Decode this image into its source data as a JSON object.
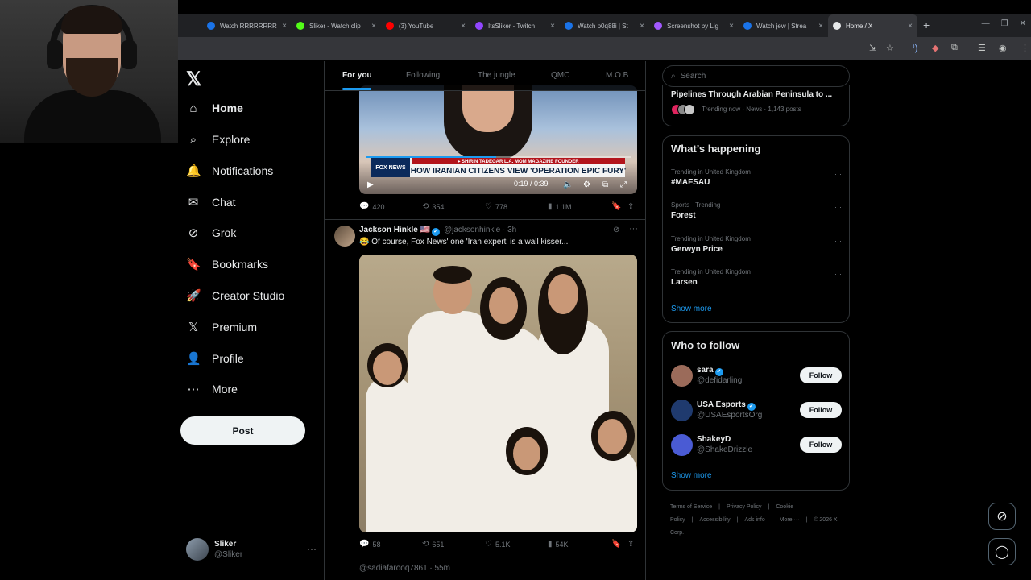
{
  "browser": {
    "tabs": [
      {
        "label": "Watch RRRRRRRR",
        "color": "#1a73e8"
      },
      {
        "label": "Sliker - Watch clip",
        "color": "#53fc18"
      },
      {
        "label": "(3) YouTube",
        "color": "#ff0000"
      },
      {
        "label": "ItsSliker - Twitch",
        "color": "#9146ff"
      },
      {
        "label": "Watch p0q88i | St",
        "color": "#1a73e8"
      },
      {
        "label": "Screenshot by Lig",
        "color": "#a259ff"
      },
      {
        "label": "Watch jew | Strea",
        "color": "#1a73e8"
      },
      {
        "label": "Home / X",
        "color": "#e7e9ea"
      }
    ],
    "new_tab": "+",
    "close_glyph": "×",
    "window_controls": [
      "—",
      "❐",
      "✕"
    ],
    "toolbar_icons": [
      "install-icon",
      "star-icon",
      "extension-icon",
      "puzzle-icon",
      "profile-icon",
      "menu-icon"
    ]
  },
  "nav": {
    "logo": "𝕏",
    "items": [
      {
        "label": "Home",
        "icon": "⌂",
        "bold": true
      },
      {
        "label": "Explore",
        "icon": "⌕"
      },
      {
        "label": "Notifications",
        "icon": "🔔"
      },
      {
        "label": "Chat",
        "icon": "✉"
      },
      {
        "label": "Grok",
        "icon": "⊘"
      },
      {
        "label": "Bookmarks",
        "icon": "🔖"
      },
      {
        "label": "Creator Studio",
        "icon": "🚀"
      },
      {
        "label": "Premium",
        "icon": "𝕏"
      },
      {
        "label": "Profile",
        "icon": "👤"
      },
      {
        "label": "More",
        "icon": "⋯"
      }
    ],
    "post_button": "Post",
    "account": {
      "name": "Sliker",
      "handle": "@Sliker",
      "more": "···"
    }
  },
  "feed": {
    "tabs": [
      "For you",
      "Following",
      "The jungle",
      "QMC",
      "M.O.B"
    ],
    "tweet1": {
      "video": {
        "ticker_top": "▸ SHIRIN TADEGAR  L.A. MOM MAGAZINE FOUNDER",
        "ticker_main": "HOW IRANIAN CITIZENS VIEW 'OPERATION EPIC FURY'",
        "channel": "FOX NEWS",
        "time": "0:19 / 0:39",
        "progress_fraction": 0.49
      },
      "stats": {
        "replies": "420",
        "reposts": "354",
        "likes": "778",
        "views": "1.1M"
      }
    },
    "tweet2": {
      "name": "Jackson Hinkle 🇺🇸",
      "handle": "@jacksonhinkle · 3h",
      "text": "😂 Of course, Fox News' one 'Iran expert' is a wall kisser...",
      "stats": {
        "replies": "58",
        "reposts": "651",
        "likes": "5.1K",
        "views": "54K"
      }
    },
    "tweet3_peek": "@sadiafarooq7861 · 55m"
  },
  "sidebar": {
    "search_placeholder": "Search",
    "trend_prev": {
      "title": "Pipelines Through Arabian Peninsula to ...",
      "meta": "Trending now · News · 1,143 posts"
    },
    "happening": {
      "title": "What’s happening",
      "trends": [
        {
          "category": "Trending in United Kingdom",
          "name": "#MAFSAU"
        },
        {
          "category": "Sports · Trending",
          "name": "Forest"
        },
        {
          "category": "Trending in United Kingdom",
          "name": "Gerwyn Price"
        },
        {
          "category": "Trending in United Kingdom",
          "name": "Larsen"
        }
      ],
      "show_more": "Show more"
    },
    "who_to_follow": {
      "title": "Who to follow",
      "users": [
        {
          "name": "sara",
          "handle": "@defidarling",
          "color": "#9b6b5a"
        },
        {
          "name": "USA Esports",
          "handle": "@USAEsportsOrg",
          "color": "#1f3a6e"
        },
        {
          "name": "ShakeyD",
          "handle": "@ShakeDrizzle",
          "color": "#4a5bd4"
        }
      ],
      "follow_label": "Follow",
      "show_more": "Show more"
    },
    "footer": {
      "links": [
        "Terms of Service",
        "|",
        "Privacy Policy",
        "|",
        "Cookie Policy",
        "|",
        "Accessibility",
        "|",
        "Ads info",
        "|",
        "More ···",
        "|",
        "© 2026 X Corp."
      ]
    }
  }
}
